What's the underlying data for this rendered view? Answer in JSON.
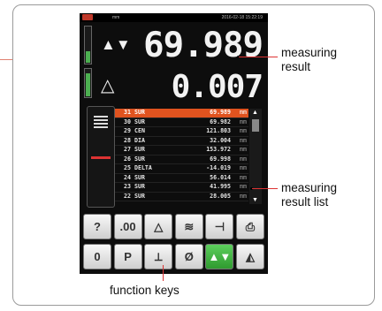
{
  "device": {
    "status_unit": "mm",
    "datetime": "2016-02-18 15:22:19",
    "main_symbol": "▲▼",
    "measuring_value": "69.989",
    "delta_symbol": "△",
    "delta_value": "0.007"
  },
  "result_list": [
    {
      "no": "31",
      "type": "SUR",
      "value": "69.989",
      "unit": "mm",
      "selected": true
    },
    {
      "no": "30",
      "type": "SUR",
      "value": "69.982",
      "unit": "mm"
    },
    {
      "no": "29",
      "type": "CEN",
      "value": "121.803",
      "unit": "mm"
    },
    {
      "no": "28",
      "type": "DIA",
      "value": "32.004",
      "unit": "mm"
    },
    {
      "no": "27",
      "type": "SUR",
      "value": "153.972",
      "unit": "mm"
    },
    {
      "no": "26",
      "type": "SUR",
      "value": "69.998",
      "unit": "mm"
    },
    {
      "no": "25",
      "type": "DELTA",
      "value": "-14.019",
      "unit": "mm"
    },
    {
      "no": "24",
      "type": "SUR",
      "value": "56.014",
      "unit": "mm"
    },
    {
      "no": "23",
      "type": "SUR",
      "value": "41.995",
      "unit": "mm"
    },
    {
      "no": "22",
      "type": "SUR",
      "value": "28.005",
      "unit": "mm"
    }
  ],
  "function_keys_row1": [
    {
      "name": "help-key",
      "glyph": "?"
    },
    {
      "name": "zero-key",
      "glyph": ".00"
    },
    {
      "name": "delta-key",
      "glyph": "△"
    },
    {
      "name": "mode-key",
      "glyph": "≋"
    },
    {
      "name": "minmax-key",
      "glyph": "⊣"
    },
    {
      "name": "print-key",
      "glyph": "⎙"
    }
  ],
  "function_keys_row2": [
    {
      "name": "preset-0-key",
      "glyph": "0"
    },
    {
      "name": "preset-p-key",
      "glyph": "P"
    },
    {
      "name": "angle-key",
      "glyph": "⟂"
    },
    {
      "name": "diameter-key",
      "glyph": "Ø"
    },
    {
      "name": "updown-key",
      "glyph": "▲▼",
      "active": true
    },
    {
      "name": "probe-key",
      "glyph": "◭"
    }
  ],
  "annotations": {
    "measuring_result": "measuring\nresult",
    "measuring_result_list": "measuring\nresult list",
    "function_keys": "function keys"
  },
  "colors": {
    "selected_row": "#e0531f",
    "active_key": "#3cae3c",
    "pointer": "#d33333"
  }
}
